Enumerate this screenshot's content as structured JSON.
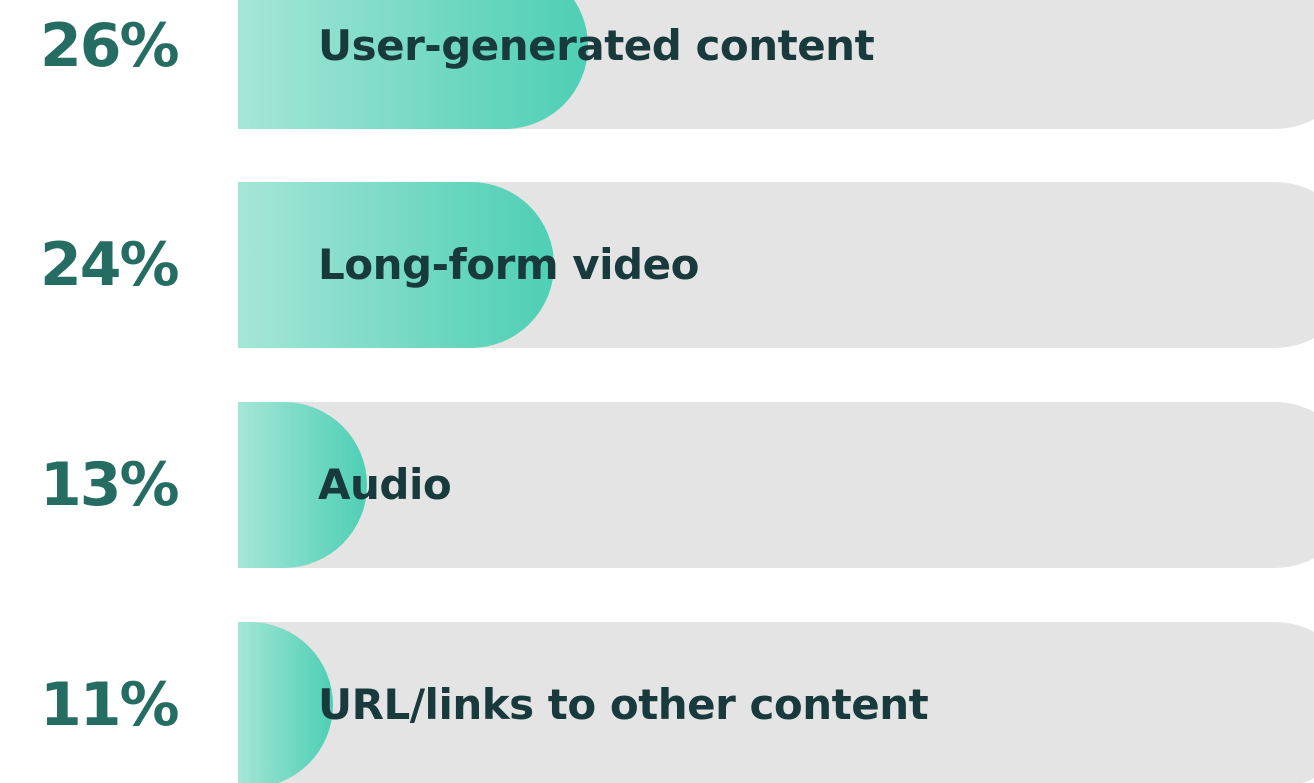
{
  "chart_data": {
    "type": "bar",
    "orientation": "horizontal",
    "categories": [
      "User-generated content",
      "Long-form video",
      "Audio",
      "URL/links to other content"
    ],
    "values": [
      26,
      24,
      13,
      11
    ],
    "value_labels": [
      "26%",
      "24%",
      "13%",
      "11%"
    ],
    "unit": "%"
  },
  "colors": {
    "value_text": "#256c62",
    "label_text": "#183a3d",
    "track": "#e4e4e4",
    "fill": "#74d9c3"
  }
}
